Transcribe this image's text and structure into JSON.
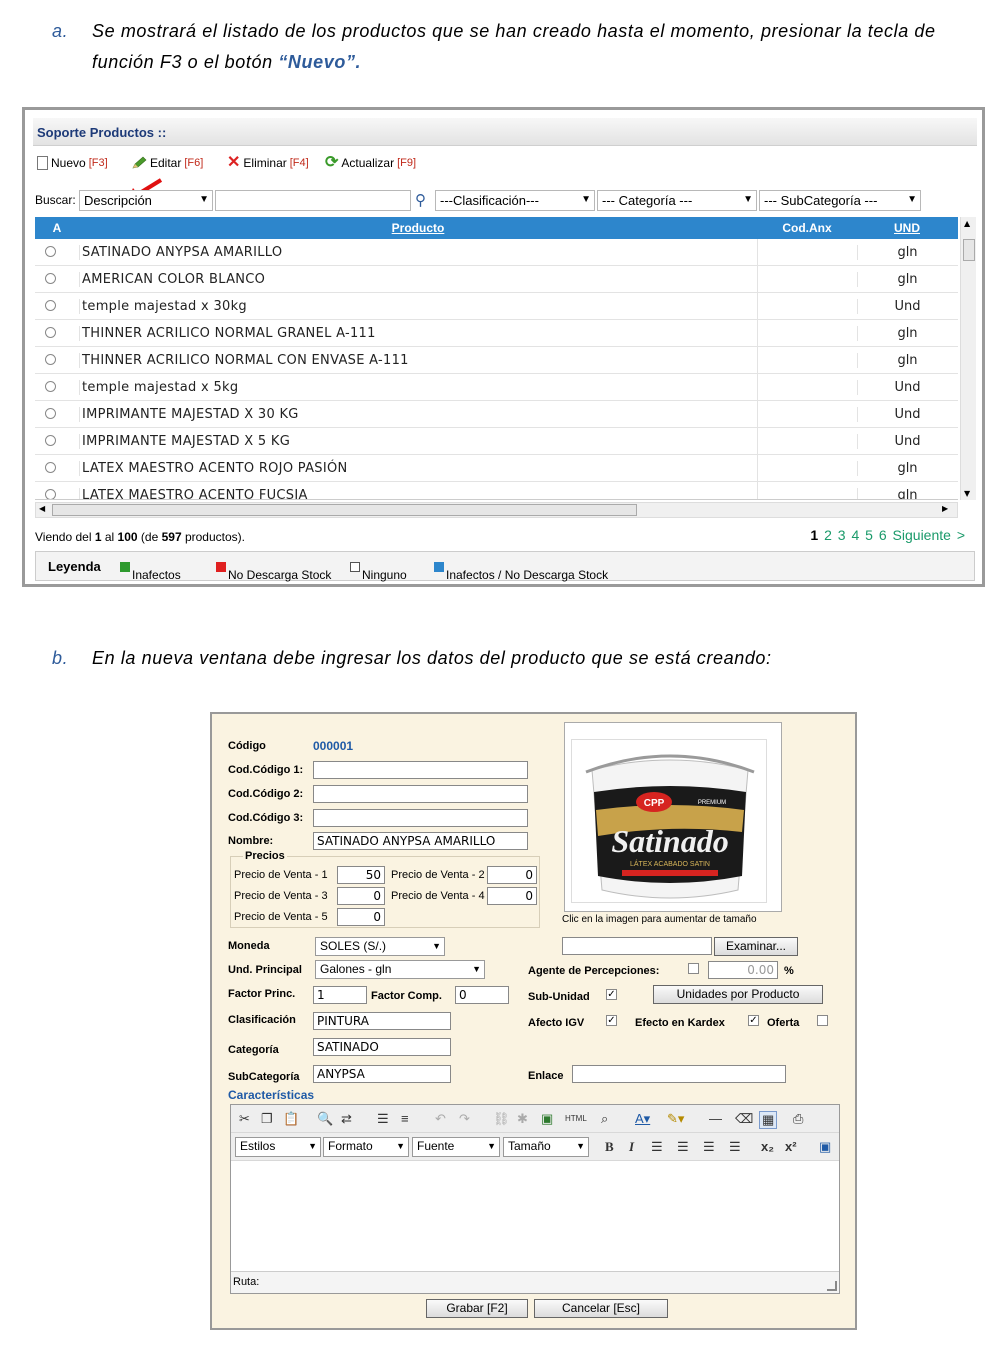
{
  "instruction_a": {
    "letter": "a.",
    "line1": "Se mostrará el listado de los productos que se han creado hasta el momento, presionar la tecla de",
    "line2_prefix": "función F3 o el botón",
    "line2_highlight": "“Nuevo”."
  },
  "instruction_b": {
    "letter": "b.",
    "text": "En la nueva ventana debe ingresar los datos del producto que se está creando:"
  },
  "productos_panel": {
    "title": "Soporte Productos ::",
    "toolbar": [
      {
        "label": "Nuevo",
        "key": "[F3]",
        "icon": "new-doc-icon"
      },
      {
        "label": "Editar",
        "key": "[F6]",
        "icon": "pencil-icon"
      },
      {
        "label": "Eliminar",
        "key": "[F4]",
        "icon": "delete-x-icon"
      },
      {
        "label": "Actualizar",
        "key": "[F9]",
        "icon": "refresh-icon"
      }
    ],
    "search": {
      "label": "Buscar:",
      "field_select": "Descripción",
      "query": "",
      "clasificacion": "---Clasificación---",
      "categoria": "--- Categoría ---",
      "subcategoria": "--- SubCategoría ---"
    },
    "columns": {
      "a": "A",
      "producto": "Producto",
      "cod_anx": "Cod.Anx",
      "und": "UND"
    },
    "rows": [
      {
        "producto": "SATINADO ANYPSA AMARILLO",
        "cod_anx": "",
        "und": "gln"
      },
      {
        "producto": "AMERICAN COLOR BLANCO",
        "cod_anx": "",
        "und": "gln"
      },
      {
        "producto": "temple majestad x 30kg",
        "cod_anx": "",
        "und": "Und"
      },
      {
        "producto": "THINNER ACRILICO NORMAL GRANEL A-111",
        "cod_anx": "",
        "und": "gln"
      },
      {
        "producto": "THINNER ACRILICO NORMAL CON ENVASE A-111",
        "cod_anx": "",
        "und": "gln"
      },
      {
        "producto": "temple majestad x 5kg",
        "cod_anx": "",
        "und": "Und"
      },
      {
        "producto": "IMPRIMANTE MAJESTAD X 30 KG",
        "cod_anx": "",
        "und": "Und"
      },
      {
        "producto": "IMPRIMANTE MAJESTAD X 5 KG",
        "cod_anx": "",
        "und": "Und"
      },
      {
        "producto": "LATEX MAESTRO ACENTO ROJO PASIÓN",
        "cod_anx": "",
        "und": "gln"
      },
      {
        "producto": "LATEX MAESTRO ACENTO FUCSIA",
        "cod_anx": "",
        "und": "gln"
      }
    ],
    "status": {
      "p1": "Viendo del ",
      "from": "1",
      "p2": " al ",
      "to": "100",
      "p3": " (de ",
      "total": "597",
      "p4": " productos)."
    },
    "pager": {
      "current": "1",
      "pages": [
        "2",
        "3",
        "4",
        "5",
        "6"
      ],
      "next": "Siguiente >"
    },
    "legend": {
      "title": "Leyenda",
      "items": [
        {
          "label": "Inafectos",
          "color": "#2e9a2e"
        },
        {
          "label": "No Descarga Stock",
          "color": "#e02020"
        },
        {
          "label": "Ninguno",
          "color": "#ffffff"
        },
        {
          "label": "Inafectos / No Descarga Stock",
          "color": "#2d86cc"
        }
      ]
    }
  },
  "producto_form": {
    "codigo_label": "Código",
    "codigo_value": "000001",
    "cod1_label": "Cod.Código 1:",
    "cod1_value": "",
    "cod2_label": "Cod.Código 2:",
    "cod2_value": "",
    "cod3_label": "Cod.Código 3:",
    "cod3_value": "",
    "nombre_label": "Nombre:",
    "nombre_value": "SATINADO ANYPSA AMARILLO",
    "precios_title": "Precios",
    "precios": [
      {
        "label": "Precio de Venta - 1",
        "value": "50"
      },
      {
        "label": "Precio de Venta - 2",
        "value": "0"
      },
      {
        "label": "Precio de Venta - 3",
        "value": "0"
      },
      {
        "label": "Precio de Venta - 4",
        "value": "0"
      },
      {
        "label": "Precio de Venta - 5",
        "value": "0"
      }
    ],
    "moneda_label": "Moneda",
    "moneda_value": "SOLES (S/.)",
    "und_label": "Und. Principal",
    "und_value": "Galones - gln",
    "factor_label": "Factor Princ.",
    "factor_value": "1",
    "factor_comp_label": "Factor Comp.",
    "factor_comp_value": "0",
    "clasificacion_label": "Clasificación",
    "clasificacion_value": "PINTURA",
    "categoria_label": "Categoría",
    "categoria_value": "SATINADO",
    "subcategoria_label": "SubCategoría",
    "subcategoria_value": "ANYPSA",
    "caracteristicas_label": "Características",
    "image_hint": "Clic en la imagen para aumentar de tamaño",
    "image_logo": "CPP",
    "image_badge": "PREMIUM",
    "image_brand": "Satinado",
    "image_sub": "LÁTEX ACABADO SATIN",
    "examinar_label": "Examinar...",
    "file_value": "",
    "agente_label": "Agente de Percepciones:",
    "agente_checked": false,
    "percepcion_value": "0.00",
    "percent_sign": "%",
    "subunidad_label": "Sub-Unidad",
    "subunidad_checked": true,
    "unidades_button": "Unidades por Producto",
    "afecto_label": "Afecto IGV",
    "afecto_checked": true,
    "kardex_label": "Efecto en Kardex",
    "kardex_checked": true,
    "oferta_label": "Oferta",
    "oferta_checked": false,
    "enlace_label": "Enlace",
    "enlace_value": "",
    "editor": {
      "estilos": "Estilos",
      "formato": "Formato",
      "fuente": "Fuente",
      "tamano": "Tamaño",
      "ruta_label": "Ruta:"
    },
    "grabar_button": "Grabar [F2]",
    "cancelar_button": "Cancelar [Esc]"
  }
}
